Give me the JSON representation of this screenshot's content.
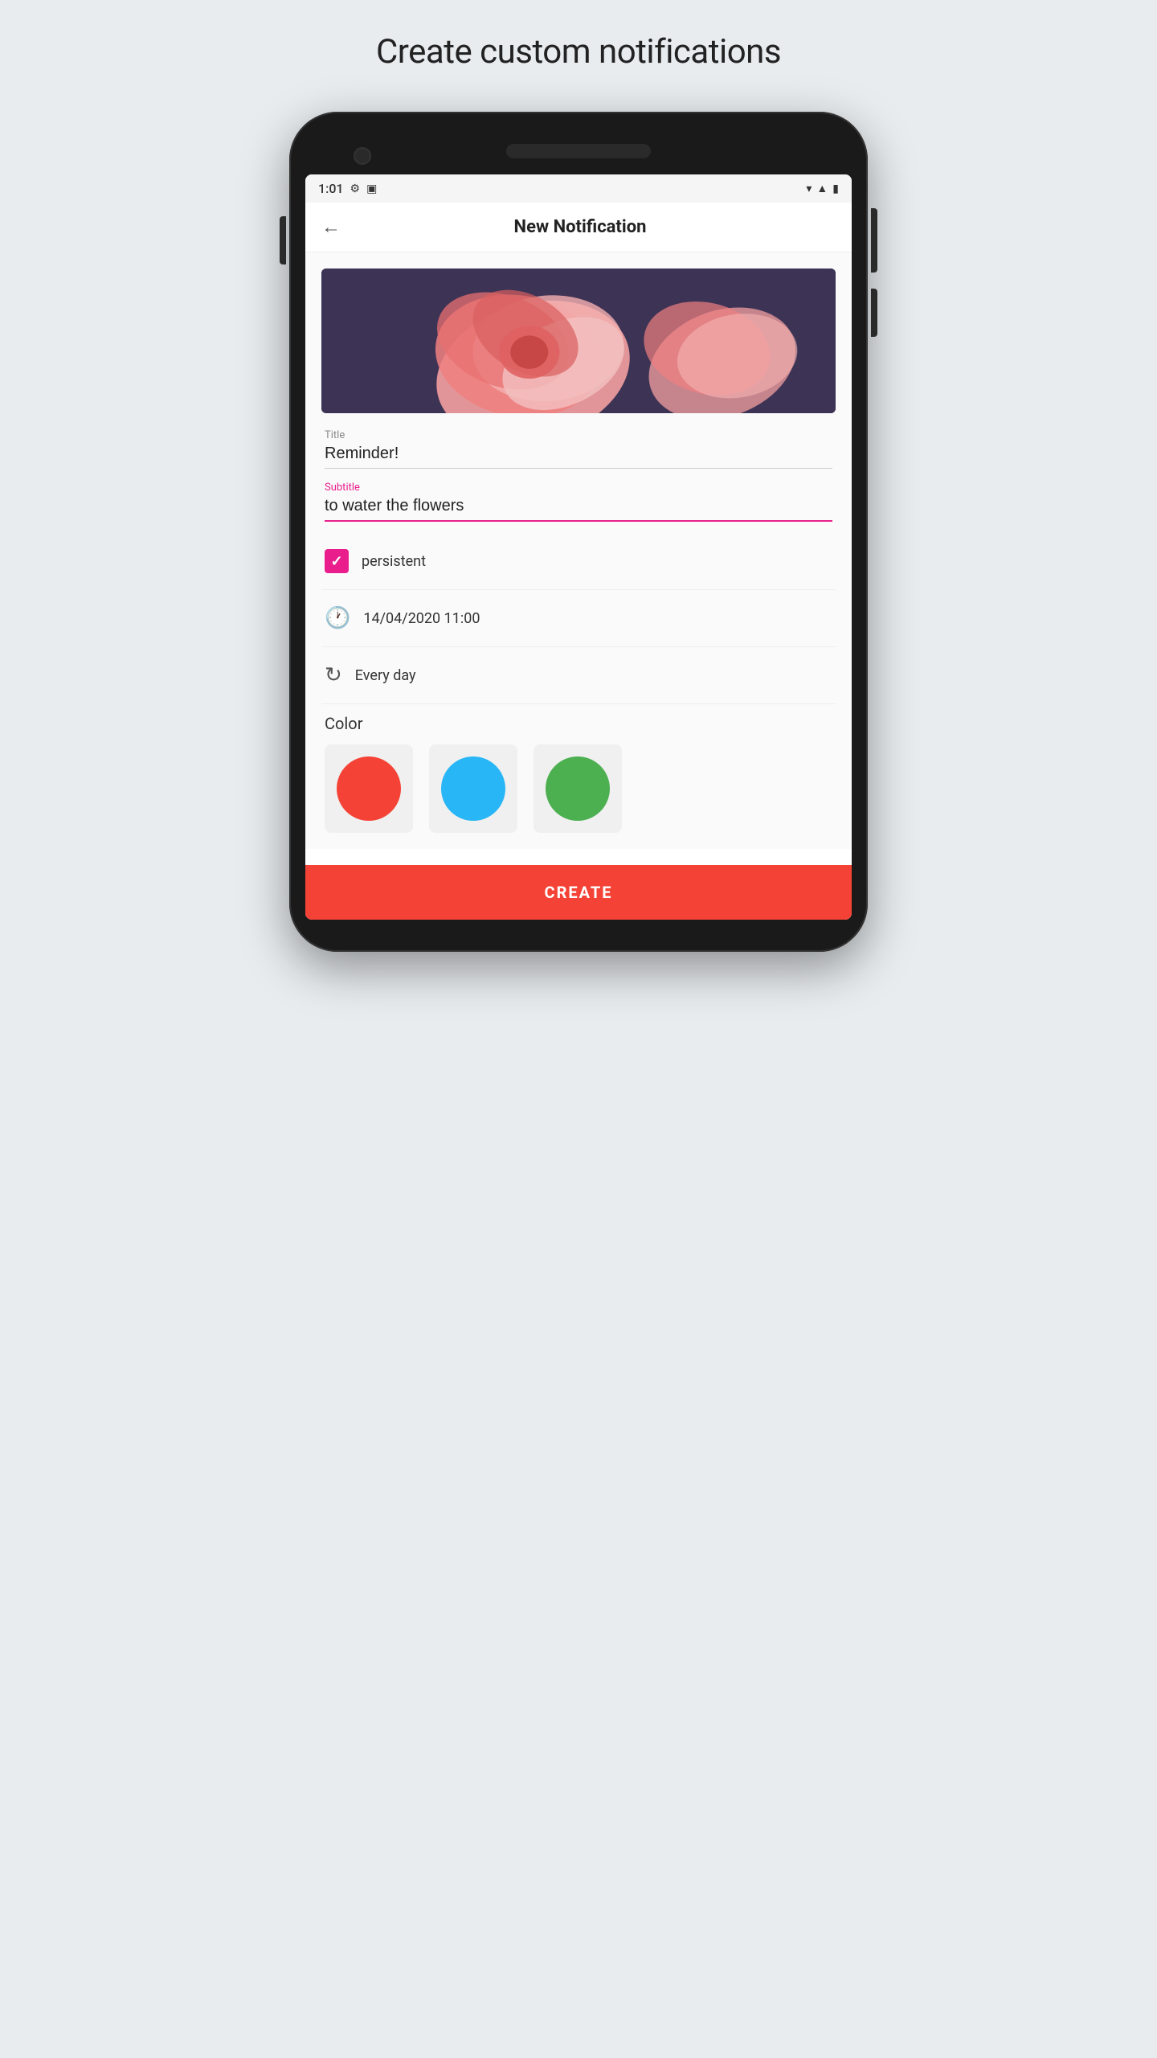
{
  "page": {
    "title": "Create custom notifications"
  },
  "status_bar": {
    "time": "1:01",
    "icons": [
      "settings",
      "storage"
    ],
    "right_icons": [
      "wifi",
      "signal",
      "battery"
    ]
  },
  "app_bar": {
    "back_label": "←",
    "title": "New Notification"
  },
  "form": {
    "title_label": "Title",
    "title_value": "Reminder!",
    "subtitle_label": "Subtitle",
    "subtitle_value": "to water the flowers",
    "persistent_label": "persistent",
    "datetime_value": "14/04/2020 11:00",
    "recurrence_value": "Every day",
    "color_label": "Color"
  },
  "create_button": {
    "label": "CREATE"
  },
  "colors": [
    {
      "name": "red",
      "hex": "#f44336"
    },
    {
      "name": "blue",
      "hex": "#29b6f6"
    },
    {
      "name": "green",
      "hex": "#4caf50"
    }
  ]
}
